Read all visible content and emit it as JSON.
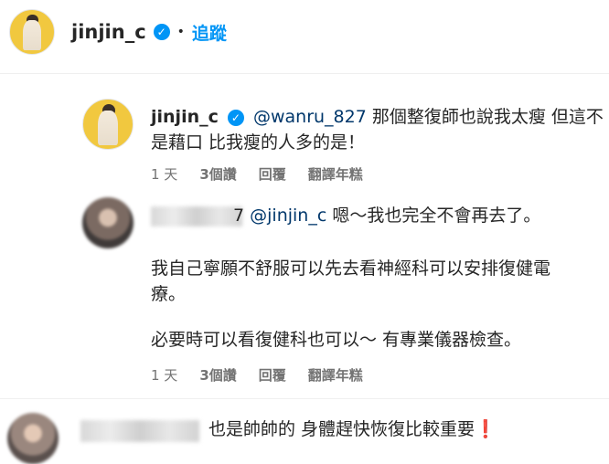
{
  "header": {
    "username": "jinjin_c",
    "verified_icon": "verified-badge-icon",
    "dot": "•",
    "follow_label": "追蹤"
  },
  "reply1": {
    "username": "jinjin_c",
    "mention": "@wanru_827",
    "text_line1": " 那個整復師也說我太瘦 但這不",
    "text_line2": "是藉口 比我瘦的人多的是！",
    "time": "1 天",
    "likes": "3個讚",
    "reply_label": "回覆",
    "translate_label": "翻譯年糕"
  },
  "reply2": {
    "username_partial": "7",
    "mention": "@jinjin_c",
    "text_line1": " 嗯～我也完全不會再去了。",
    "text_line2": "我自己寧願不舒服可以先去看神經科可以安排復健電",
    "text_line3": "療。",
    "text_line4": "必要時可以看復健科也可以～ 有專業儀器檢查。",
    "time": "1 天",
    "likes": "3個讚",
    "reply_label": "回覆",
    "translate_label": "翻譯年糕"
  },
  "comment3": {
    "text": "也是帥帥的 身體趕快恢復比較重要",
    "emoji": "❗"
  },
  "colors": {
    "link_blue": "#0095f6",
    "mention_blue": "#00376b",
    "meta_gray": "#737373"
  }
}
